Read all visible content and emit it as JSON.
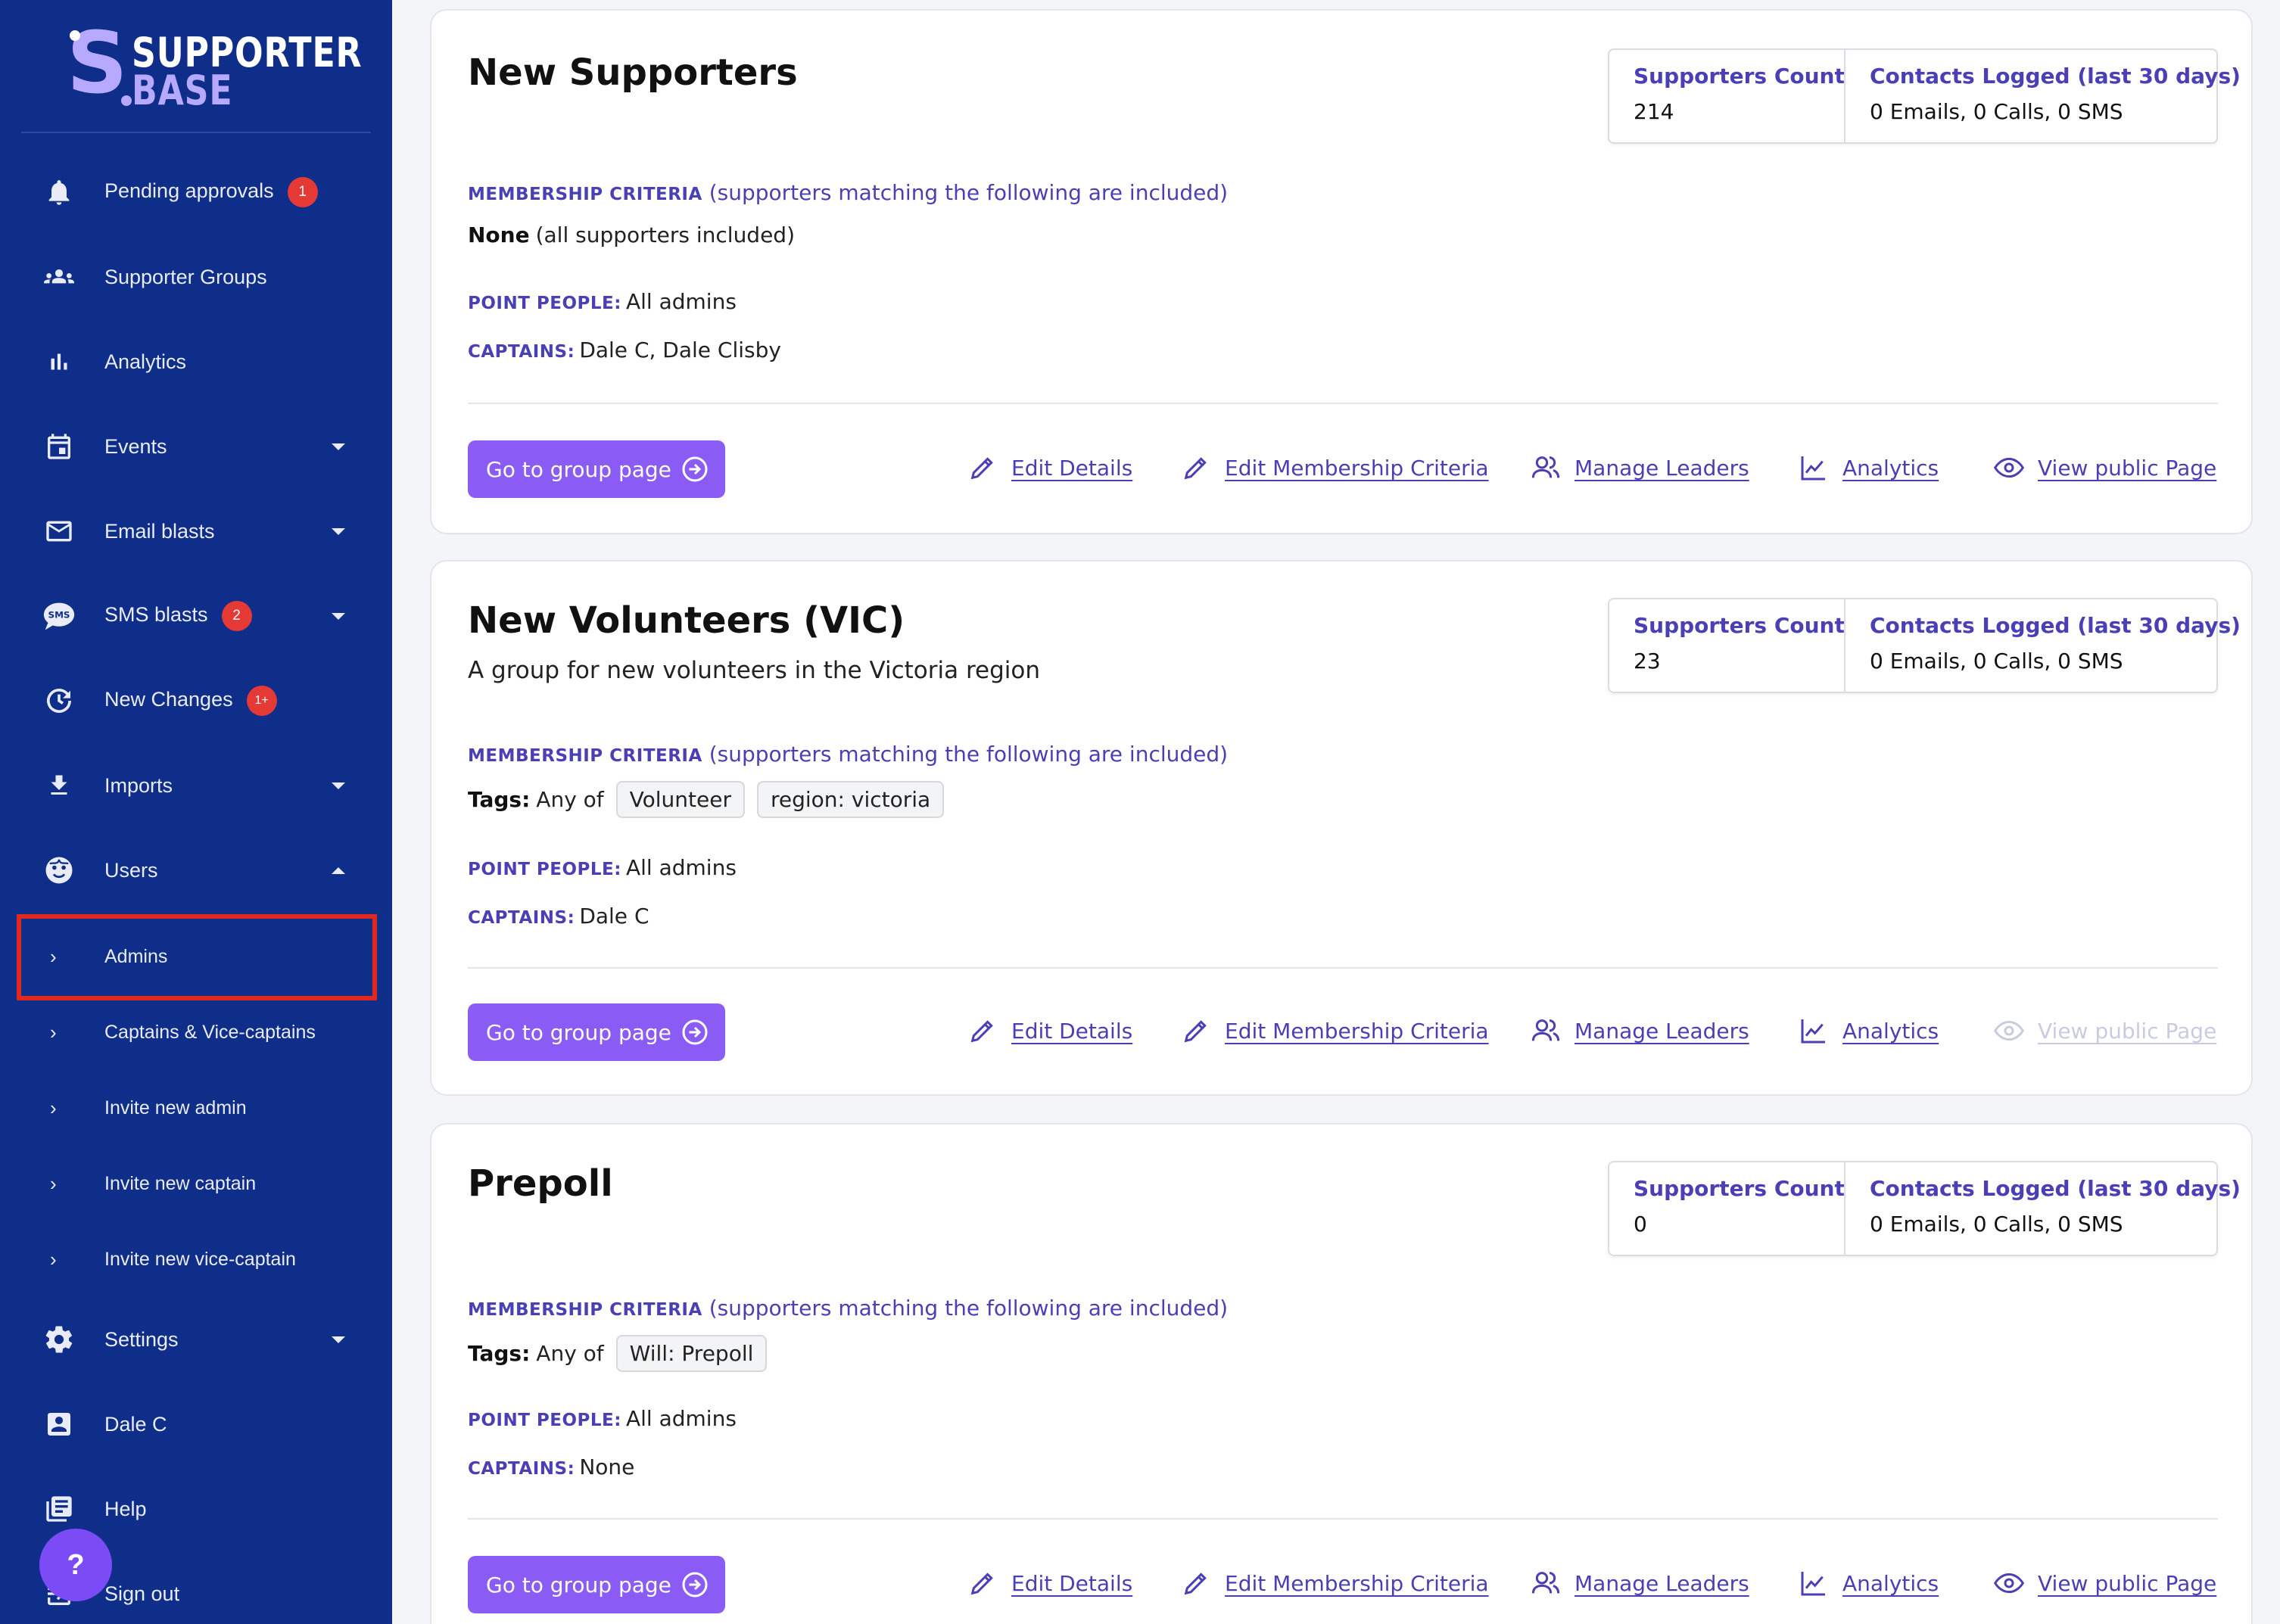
{
  "brand": {
    "line1": "SUPPORTER",
    "line2": "BASE",
    "mark": "S"
  },
  "sidebar": {
    "items": [
      {
        "label": "Pending approvals",
        "icon": "bell-icon",
        "badge": "1"
      },
      {
        "label": "Supporter Groups",
        "icon": "group-icon"
      },
      {
        "label": "Analytics",
        "icon": "bar-chart-icon"
      },
      {
        "label": "Events",
        "icon": "calendar-icon",
        "expandable": "down"
      },
      {
        "label": "Email blasts",
        "icon": "mail-icon",
        "expandable": "down"
      },
      {
        "label": "SMS blasts",
        "icon": "sms-icon",
        "badge": "2",
        "expandable": "down"
      },
      {
        "label": "New Changes",
        "icon": "history-icon",
        "badge": "1+"
      },
      {
        "label": "Imports",
        "icon": "download-icon",
        "expandable": "down"
      },
      {
        "label": "Users",
        "icon": "face-icon",
        "expandable": "up"
      }
    ],
    "users_sub": [
      {
        "label": "Admins"
      },
      {
        "label": "Captains & Vice-captains"
      },
      {
        "label": "Invite new admin"
      },
      {
        "label": "Invite new captain"
      },
      {
        "label": "Invite new vice-captain"
      }
    ],
    "bottom": [
      {
        "label": "Settings",
        "icon": "gear-icon",
        "expandable": "down"
      },
      {
        "label": "Dale C",
        "icon": "account-box-icon"
      },
      {
        "label": "Help",
        "icon": "book-icon"
      },
      {
        "label": "Sign out",
        "icon": "logout-icon"
      }
    ],
    "help_fab": "?"
  },
  "labels": {
    "supporters_count": "Supporters Count",
    "contacts_logged": "Contacts Logged (last 30 days)",
    "membership_criteria": "MEMBERSHIP CRITERIA",
    "membership_note": "(supporters matching the following are included)",
    "point_people": "POINT PEOPLE:",
    "captains": "CAPTAINS:",
    "tags": "Tags:",
    "any_of": "Any of",
    "go_to_group": "Go to group page",
    "edit_details": "Edit Details",
    "edit_criteria": "Edit Membership Criteria",
    "manage_leaders": "Manage Leaders",
    "analytics": "Analytics",
    "view_public": "View public Page"
  },
  "groups": [
    {
      "title": "New Supporters",
      "description": "",
      "count": "214",
      "contacts": "0 Emails, 0 Calls, 0 SMS",
      "criteria_none_bold": "None",
      "criteria_none_rest": "(all supporters included)",
      "point_people": "All admins",
      "captains": "Dale C, Dale Clisby",
      "public_enabled": true
    },
    {
      "title": "New Volunteers (VIC)",
      "description": "A group for new volunteers in the Victoria region",
      "count": "23",
      "contacts": "0 Emails, 0 Calls, 0 SMS",
      "tags": [
        "Volunteer",
        "region: victoria"
      ],
      "point_people": "All admins",
      "captains": "Dale C",
      "public_enabled": false
    },
    {
      "title": "Prepoll",
      "description": "",
      "count": "0",
      "contacts": "0 Emails, 0 Calls, 0 SMS",
      "tags": [
        "Will: Prepoll"
      ],
      "point_people": "All admins",
      "captains": "None",
      "public_enabled": true
    }
  ],
  "colors": {
    "sidebar": "#0f2e8a",
    "accent": "#8a5cf5",
    "link": "#4a3fb5",
    "badge": "#e53935",
    "highlight": "#e0281e"
  }
}
